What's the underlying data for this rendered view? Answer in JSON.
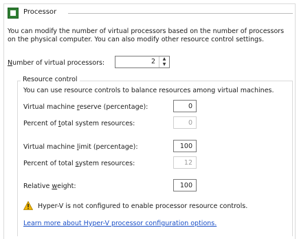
{
  "header": {
    "title": "Processor",
    "icon": "processor-icon"
  },
  "description": "You can modify the number of virtual processors based on the number of processors on the physical computer. You can also modify other resource control settings.",
  "processors": {
    "label_prefix": "N",
    "label_rest": "umber of virtual processors:",
    "value": "2"
  },
  "resource_control": {
    "title": "Resource control",
    "intro": "You can use resource controls to balance resources among virtual machines.",
    "reserve": {
      "label_a": "Virtual machine ",
      "label_u": "r",
      "label_b": "eserve (percentage):",
      "value": "0"
    },
    "reserve_percent": {
      "label_a": "Percent of ",
      "label_u": "t",
      "label_b": "otal system resources:",
      "value": "0"
    },
    "limit": {
      "label_a": "Virtual machine ",
      "label_u": "l",
      "label_b": "imit (percentage):",
      "value": "100"
    },
    "limit_percent": {
      "label_a": "Percent of total ",
      "label_u": "s",
      "label_b": "ystem resources:",
      "value": "12"
    },
    "weight": {
      "label_a": "Relative ",
      "label_u": "w",
      "label_b": "eight:",
      "value": "100"
    }
  },
  "warning": {
    "icon": "warning-icon",
    "text": "Hyper-V is not configured to enable processor resource controls.",
    "color": "#f2b600"
  },
  "link": {
    "text": "Learn more about Hyper-V processor configuration options.",
    "color": "#1a4fc7"
  }
}
